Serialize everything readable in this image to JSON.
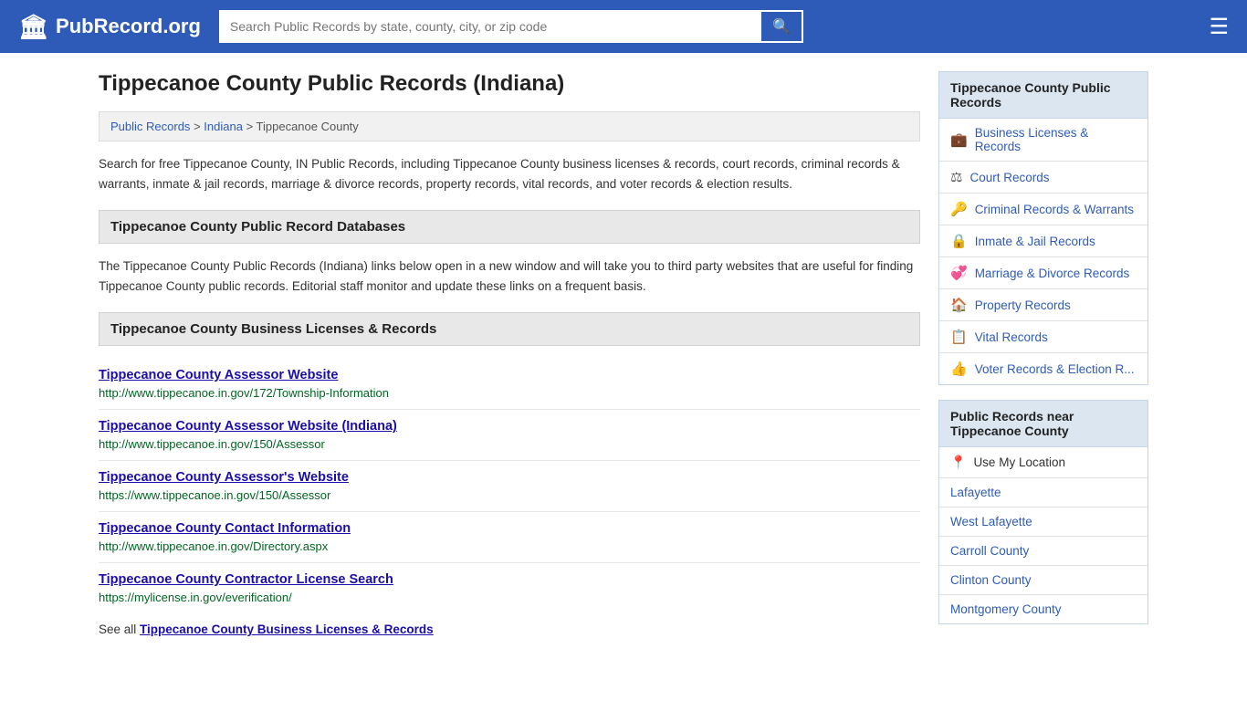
{
  "header": {
    "logo_text": "PubRecord.org",
    "logo_icon": "🏛",
    "search_placeholder": "Search Public Records by state, county, city, or zip code",
    "search_icon": "🔍",
    "menu_icon": "☰"
  },
  "page": {
    "title": "Tippecanoe County Public Records (Indiana)",
    "breadcrumb": {
      "items": [
        "Public Records",
        "Indiana",
        "Tippecanoe County"
      ]
    },
    "intro": "Search for free Tippecanoe County, IN Public Records, including Tippecanoe County business licenses & records, court records, criminal records & warrants, inmate & jail records, marriage & divorce records, property records, vital records, and voter records & election results.",
    "databases_heading": "Tippecanoe County Public Record Databases",
    "databases_desc": "The Tippecanoe County Public Records (Indiana) links below open in a new window and will take you to third party websites that are useful for finding Tippecanoe County public records. Editorial staff monitor and update these links on a frequent basis.",
    "business_section_heading": "Tippecanoe County Business Licenses & Records",
    "records": [
      {
        "title": "Tippecanoe County Assessor Website",
        "url": "http://www.tippecanoe.in.gov/172/Township-Information"
      },
      {
        "title": "Tippecanoe County Assessor Website (Indiana)",
        "url": "http://www.tippecanoe.in.gov/150/Assessor"
      },
      {
        "title": "Tippecanoe County Assessor's Website",
        "url": "https://www.tippecanoe.in.gov/150/Assessor"
      },
      {
        "title": "Tippecanoe County Contact Information",
        "url": "http://www.tippecanoe.in.gov/Directory.aspx"
      },
      {
        "title": "Tippecanoe County Contractor License Search",
        "url": "https://mylicense.in.gov/everification/"
      }
    ],
    "see_all_label": "See all",
    "see_all_link_text": "Tippecanoe County Business Licenses & Records"
  },
  "sidebar": {
    "records_title": "Tippecanoe County Public Records",
    "items": [
      {
        "icon": "💼",
        "label": "Business Licenses & Records"
      },
      {
        "icon": "⚖",
        "label": "Court Records"
      },
      {
        "icon": "🔑",
        "label": "Criminal Records & Warrants"
      },
      {
        "icon": "🔒",
        "label": "Inmate & Jail Records"
      },
      {
        "icon": "💞",
        "label": "Marriage & Divorce Records"
      },
      {
        "icon": "🏠",
        "label": "Property Records"
      },
      {
        "icon": "📋",
        "label": "Vital Records"
      },
      {
        "icon": "👍",
        "label": "Voter Records & Election R..."
      }
    ],
    "nearby_title": "Public Records near Tippecanoe County",
    "nearby_items": [
      {
        "icon": "📍",
        "label": "Use My Location",
        "is_location": true
      },
      {
        "label": "Lafayette"
      },
      {
        "label": "West Lafayette"
      },
      {
        "label": "Carroll County"
      },
      {
        "label": "Clinton County"
      },
      {
        "label": "Montgomery County"
      }
    ]
  }
}
